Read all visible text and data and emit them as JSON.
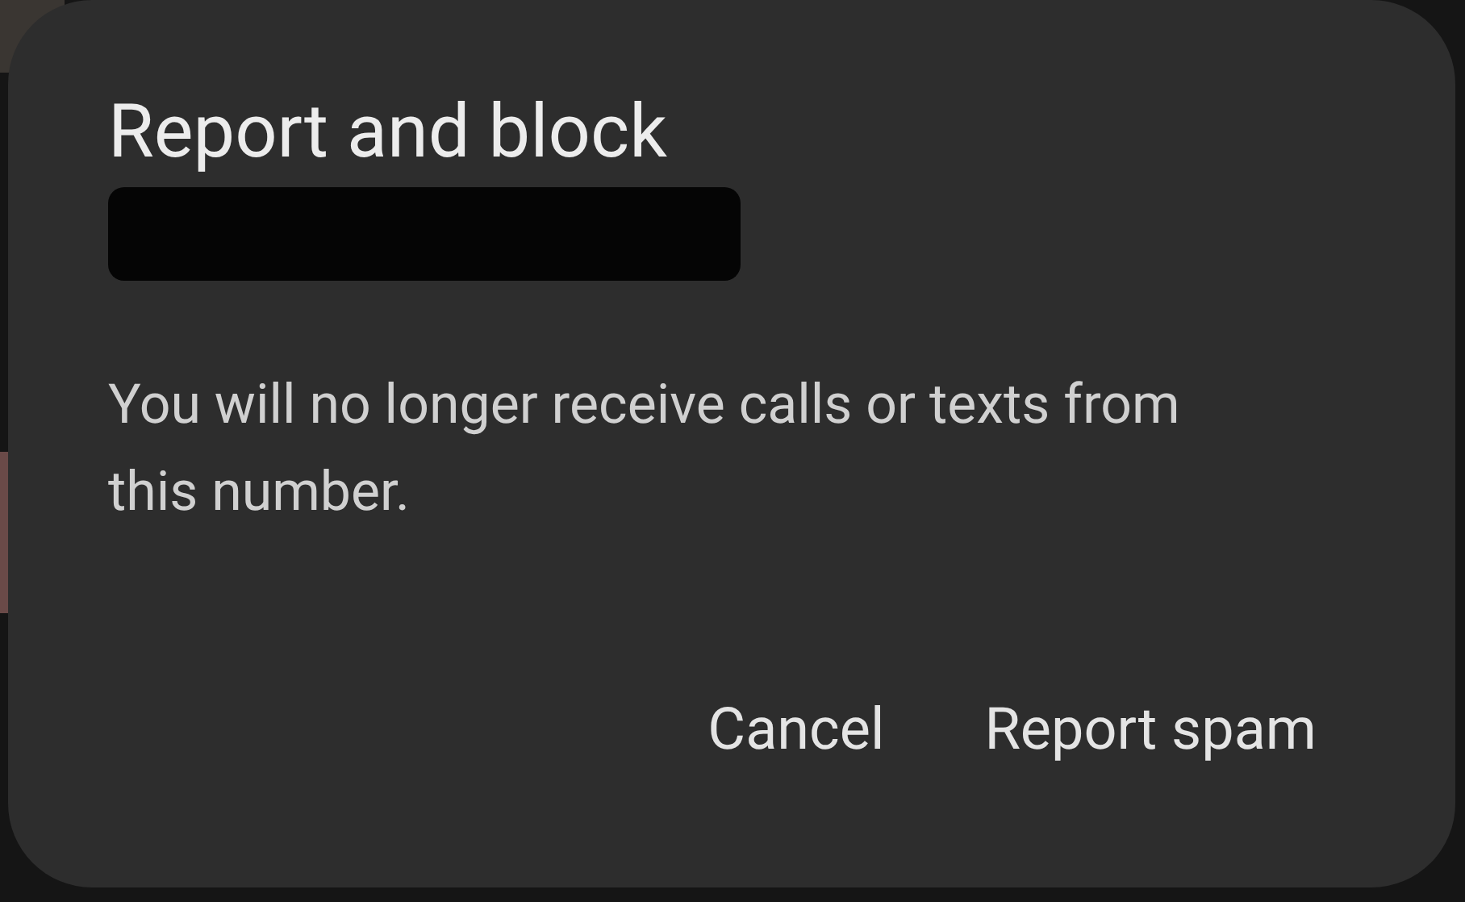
{
  "dialog": {
    "title": "Report and block",
    "message": "You will no longer receive calls or texts from this number.",
    "buttons": [
      {
        "label": "Cancel"
      },
      {
        "label": "Report spam"
      }
    ]
  }
}
